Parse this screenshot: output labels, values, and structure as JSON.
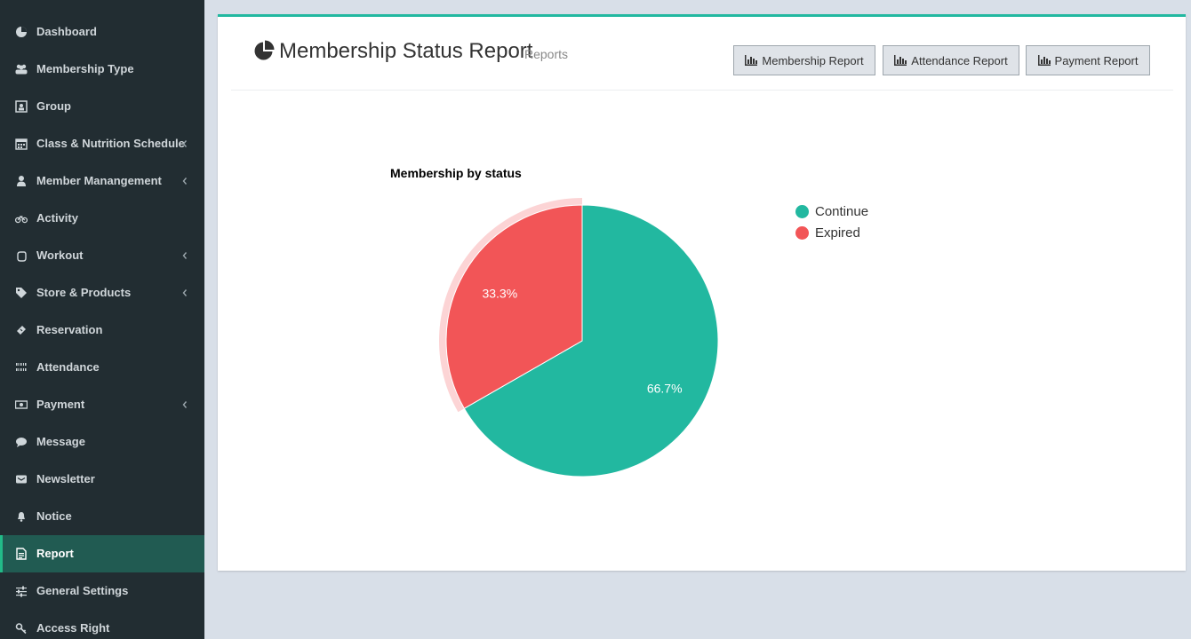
{
  "sidebar": {
    "items": [
      {
        "label": "Dashboard",
        "icon": "dashboard-icon",
        "has_submenu": false,
        "active": false
      },
      {
        "label": "Membership Type",
        "icon": "users-icon",
        "has_submenu": false,
        "active": false
      },
      {
        "label": "Group",
        "icon": "group-icon",
        "has_submenu": false,
        "active": false
      },
      {
        "label": "Class & Nutrition Schedule",
        "icon": "calendar-icon",
        "has_submenu": true,
        "active": false
      },
      {
        "label": "Member Manangement",
        "icon": "user-icon",
        "has_submenu": true,
        "active": false
      },
      {
        "label": "Activity",
        "icon": "bicycle-icon",
        "has_submenu": false,
        "active": false
      },
      {
        "label": "Workout",
        "icon": "hand-icon",
        "has_submenu": true,
        "active": false
      },
      {
        "label": "Store & Products",
        "icon": "tags-icon",
        "has_submenu": true,
        "active": false
      },
      {
        "label": "Reservation",
        "icon": "ticket-icon",
        "has_submenu": false,
        "active": false
      },
      {
        "label": "Attendance",
        "icon": "barcode-icon",
        "has_submenu": false,
        "active": false
      },
      {
        "label": "Payment",
        "icon": "money-icon",
        "has_submenu": true,
        "active": false
      },
      {
        "label": "Message",
        "icon": "comment-icon",
        "has_submenu": false,
        "active": false
      },
      {
        "label": "Newsletter",
        "icon": "envelope-icon",
        "has_submenu": false,
        "active": false
      },
      {
        "label": "Notice",
        "icon": "bell-icon",
        "has_submenu": false,
        "active": false
      },
      {
        "label": "Report",
        "icon": "file-text-icon",
        "has_submenu": false,
        "active": true
      },
      {
        "label": "General Settings",
        "icon": "sliders-icon",
        "has_submenu": false,
        "active": false
      },
      {
        "label": "Access Right",
        "icon": "key-icon",
        "has_submenu": false,
        "active": false
      }
    ]
  },
  "header": {
    "title": "Membership Status Report",
    "subtitle": "Reports",
    "title_icon": "pie-chart-icon",
    "buttons": [
      {
        "label": "Membership Report",
        "icon": "bar-chart-icon"
      },
      {
        "label": "Attendance Report",
        "icon": "bar-chart-icon"
      },
      {
        "label": "Payment Report",
        "icon": "bar-chart-icon"
      }
    ]
  },
  "chart_data": {
    "type": "pie",
    "title": "Membership by status",
    "categories": [
      "Continue",
      "Expired"
    ],
    "values": [
      66.7,
      33.3
    ],
    "value_labels": [
      "66.7%",
      "33.3%"
    ],
    "colors": [
      "#22b8a0",
      "#f25557"
    ],
    "highlighted": "Expired",
    "legend_position": "right"
  },
  "colors": {
    "sidebar_bg": "#222d32",
    "sidebar_active": "#215b52",
    "accent": "#22b8a0",
    "page_bg": "#d8dfe8"
  }
}
